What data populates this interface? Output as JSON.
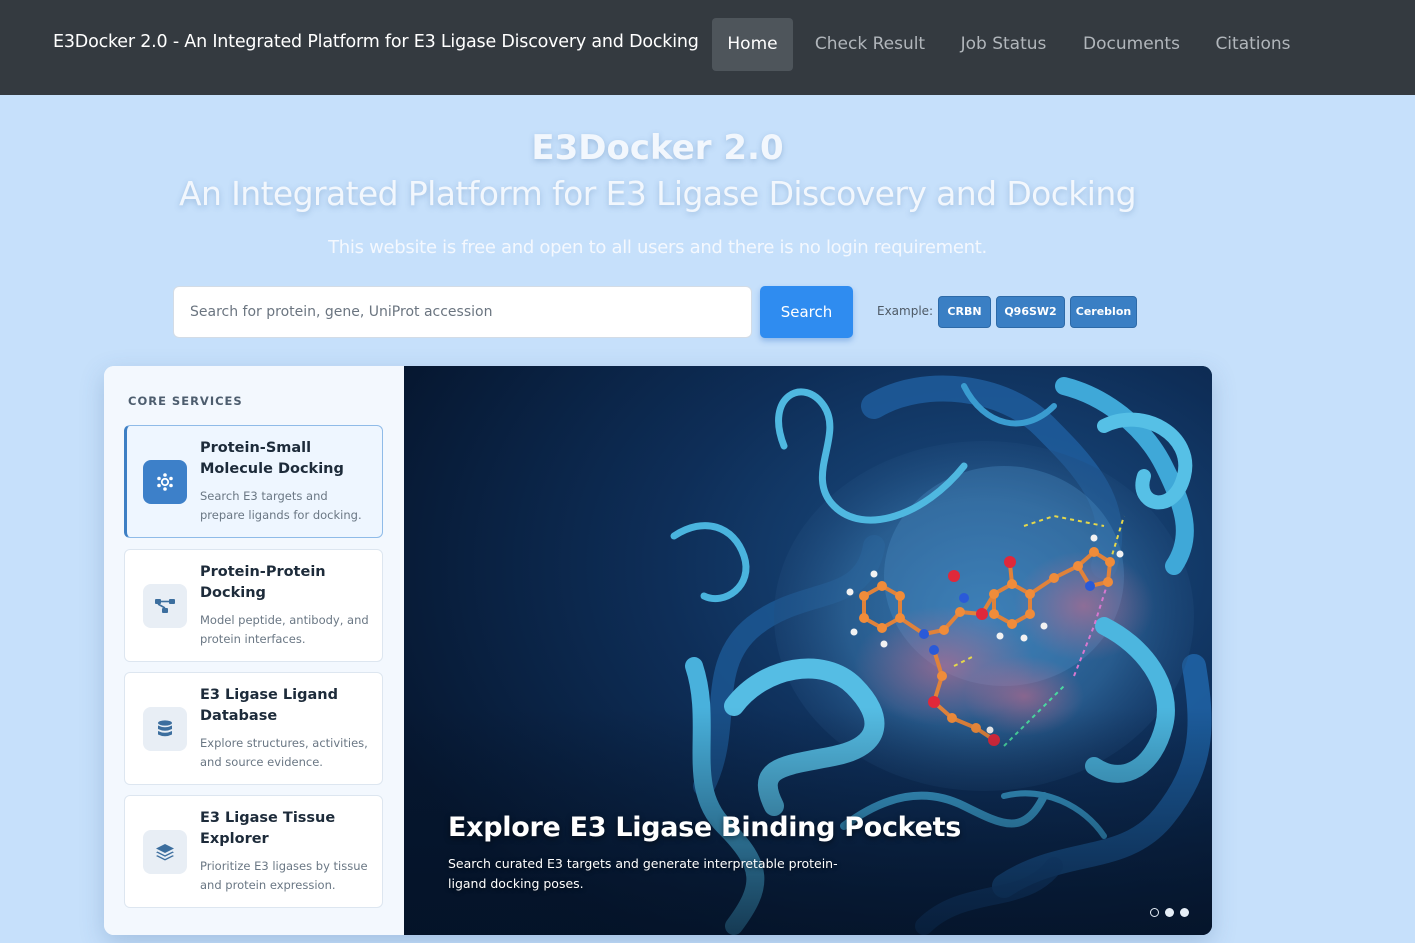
{
  "navbar": {
    "brand": "E3Docker 2.0 - An Integrated Platform for E3 Ligase Discovery and Docking",
    "items": [
      {
        "label": "Home",
        "active": true
      },
      {
        "label": "Check Result",
        "active": false
      },
      {
        "label": "Job Status",
        "active": false
      },
      {
        "label": "Documents",
        "active": false
      },
      {
        "label": "Citations",
        "active": false
      }
    ]
  },
  "hero": {
    "title": "E3Docker 2.0",
    "subtitle": "An Integrated Platform for E3 Ligase Discovery and Docking",
    "note": "This website is free and open to all users and there is no login requirement."
  },
  "search": {
    "placeholder": "Search for protein, gene, UniProt accession",
    "value": "",
    "button_label": "Search",
    "example_label": "Example:",
    "examples": [
      "CRBN",
      "Q96SW2",
      "Cereblon"
    ]
  },
  "services": {
    "heading": "CORE SERVICES",
    "items": [
      {
        "title": "Protein-Small Molecule Docking",
        "description": "Search E3 targets and prepare ligands for docking.",
        "icon": "molecule-icon",
        "active": true
      },
      {
        "title": "Protein-Protein Docking",
        "description": "Model peptide, antibody, and protein interfaces.",
        "icon": "network-icon",
        "active": false
      },
      {
        "title": "E3 Ligase Ligand Database",
        "description": "Explore structures, activities, and source evidence.",
        "icon": "database-icon",
        "active": false
      },
      {
        "title": "E3 Ligase Tissue Explorer",
        "description": "Prioritize E3 ligases by tissue and protein expression.",
        "icon": "layers-icon",
        "active": false
      }
    ]
  },
  "carousel": {
    "slide_title": "Explore E3 Ligase Binding Pockets",
    "slide_description": "Search curated E3 targets and generate interpretable protein-ligand docking poses.",
    "slide_count": 3,
    "active_slide": 1
  },
  "colors": {
    "navbar": "#343a40",
    "page_background": "#c6e0fb",
    "accent": "#2f8cf0",
    "chip": "#3a7fc4"
  }
}
